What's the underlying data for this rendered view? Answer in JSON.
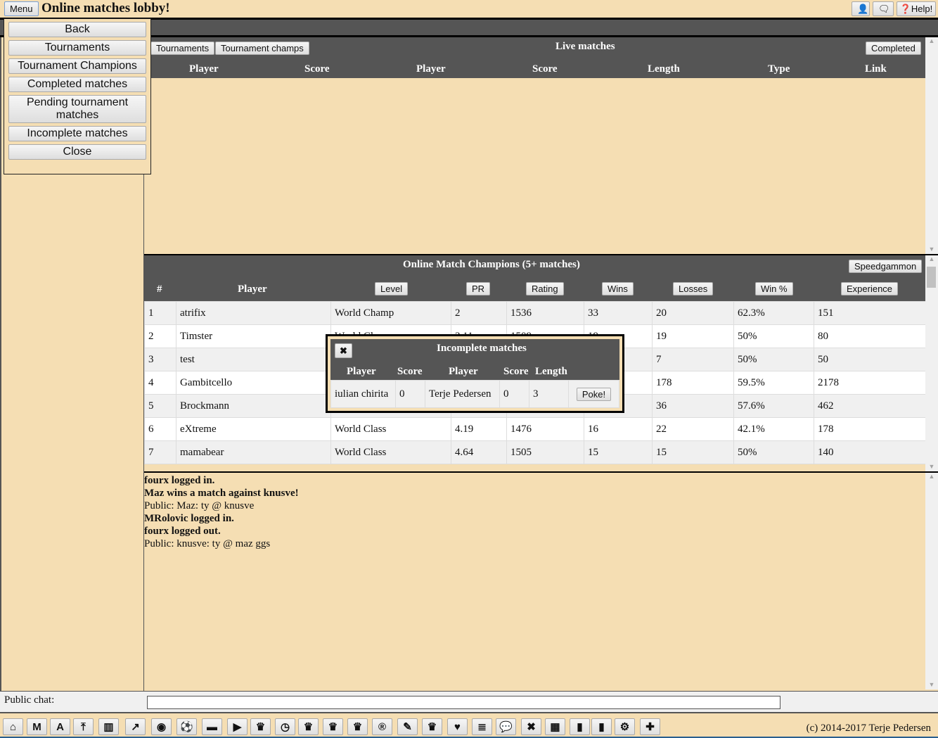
{
  "topbar": {
    "menu_label": "Menu",
    "title": "Online matches lobby!",
    "user_icon": "user-icon",
    "chat_icon": "chat-bubbles-icon",
    "help_label": "Help!"
  },
  "live": {
    "title": "Live matches",
    "tournaments_btn": "Tournaments",
    "tournament_champs_btn": "Tournament champs",
    "completed_btn": "Completed",
    "columns": [
      "Player",
      "Score",
      "Player",
      "Score",
      "Length",
      "Type",
      "Link"
    ]
  },
  "champions": {
    "title": "Online Match Champions (5+ matches)",
    "speedgammon_btn": "Speedgammon",
    "col_rank": "#",
    "col_player": "Player",
    "sort_buttons": [
      "Level",
      "PR",
      "Rating",
      "Wins",
      "Losses",
      "Win %",
      "Experience"
    ],
    "rows": [
      [
        "1",
        "atrifix",
        "World Champ",
        "2",
        "1536",
        "33",
        "20",
        "62.3%",
        "151"
      ],
      [
        "2",
        "Timster",
        "World Class",
        "3.11",
        "1509",
        "19",
        "19",
        "50%",
        "80"
      ],
      [
        "3",
        "test",
        "",
        "",
        "",
        "",
        "7",
        "50%",
        "50"
      ],
      [
        "4",
        "Gambitcello",
        "",
        "",
        "",
        "",
        "178",
        "59.5%",
        "2178"
      ],
      [
        "5",
        "Brockmann",
        "",
        "",
        "",
        "",
        "36",
        "57.6%",
        "462"
      ],
      [
        "6",
        "eXtreme",
        "World Class",
        "4.19",
        "1476",
        "16",
        "22",
        "42.1%",
        "178"
      ],
      [
        "7",
        "mamabear",
        "World Class",
        "4.64",
        "1505",
        "15",
        "15",
        "50%",
        "140"
      ]
    ]
  },
  "chat_log": [
    {
      "text": "fourx logged in.",
      "bold": true
    },
    {
      "text": "Maz wins a match against knusve!",
      "bold": true
    },
    {
      "text": "Public: Maz: ty @ knusve",
      "bold": false
    },
    {
      "text": "MRolovic logged in.",
      "bold": true
    },
    {
      "text": "fourx logged out.",
      "bold": true
    },
    {
      "text": "Public: knusve: ty @ maz ggs",
      "bold": false
    }
  ],
  "public_chat": {
    "label": "Public chat:",
    "value": ""
  },
  "menu": {
    "items": [
      "Back",
      "Tournaments",
      "Tournament Champions",
      "Completed matches",
      "Pending tournament matches",
      "Incomplete matches",
      "Close"
    ]
  },
  "popup": {
    "title": "Incomplete matches",
    "close_icon": "close-icon",
    "columns": [
      "Player",
      "Score",
      "Player",
      "Score",
      "Length"
    ],
    "row": [
      "iulian chirita",
      "0",
      "Terje Pedersen",
      "0",
      "3"
    ],
    "poke_label": "Poke!"
  },
  "toolbar": {
    "icons": [
      {
        "name": "home-icon",
        "glyph": "⌂"
      },
      {
        "name": "m-letter-icon",
        "glyph": "M"
      },
      {
        "name": "a-letter-icon",
        "glyph": "A"
      },
      {
        "name": "upload-icon",
        "glyph": "⤒"
      },
      {
        "name": "bar-chart-icon",
        "glyph": "▥"
      },
      {
        "name": "line-chart-icon",
        "glyph": "↗"
      },
      {
        "name": "eye-icon",
        "glyph": "◉"
      },
      {
        "name": "soccer-ball-icon",
        "glyph": "⚽"
      },
      {
        "name": "archive-icon",
        "glyph": "▬"
      },
      {
        "name": "play-icon",
        "glyph": "▶"
      },
      {
        "name": "trophy-icon",
        "glyph": "♛"
      },
      {
        "name": "clock-icon",
        "glyph": "◷"
      },
      {
        "name": "trophy-icon",
        "glyph": "♛"
      },
      {
        "name": "trophy-icon",
        "glyph": "♛"
      },
      {
        "name": "trophy-icon",
        "glyph": "♛"
      },
      {
        "name": "registered-icon",
        "glyph": "®"
      },
      {
        "name": "edit-icon",
        "glyph": "✎"
      },
      {
        "name": "trophy-icon",
        "glyph": "♛"
      },
      {
        "name": "heart-icon",
        "glyph": "♥"
      },
      {
        "name": "database-icon",
        "glyph": "≣"
      },
      {
        "name": "chat-bubbles-icon",
        "glyph": "💬"
      },
      {
        "name": "close-icon",
        "glyph": "✖"
      },
      {
        "name": "film-icon",
        "glyph": "▦"
      },
      {
        "name": "bookmark-icon",
        "glyph": "▮"
      },
      {
        "name": "bookmark-icon",
        "glyph": "▮"
      },
      {
        "name": "cogs-icon",
        "glyph": "⚙"
      },
      {
        "name": "plus-icon",
        "glyph": "✚"
      }
    ],
    "copyright": "(c) 2014-2017 Terje Pedersen"
  },
  "colors": {
    "panel_header": "#555555",
    "background": "#f5deb3"
  }
}
